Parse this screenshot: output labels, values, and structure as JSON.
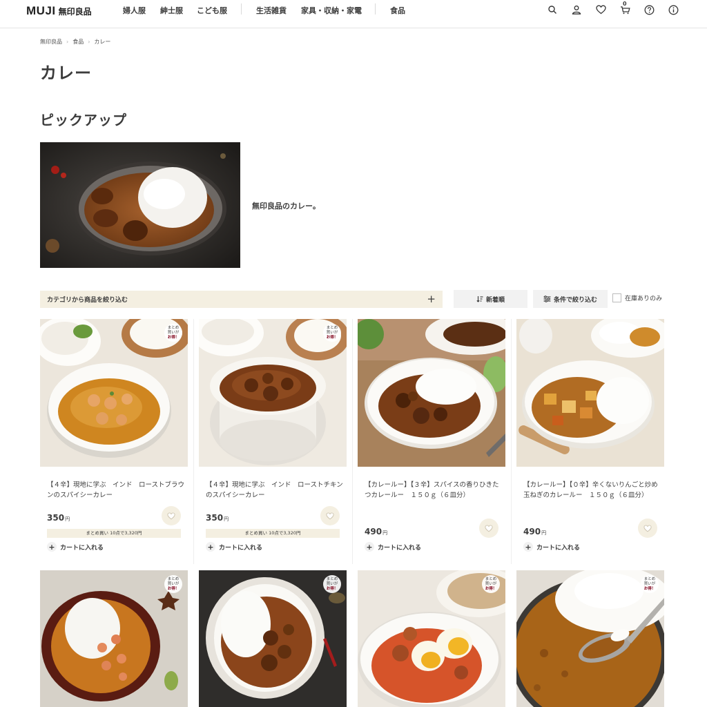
{
  "header": {
    "logo_en": "MUJI",
    "logo_jp": "無印良品",
    "nav": [
      "婦人服",
      "紳士服",
      "こども服",
      "生活雑貨",
      "家具・収納・家電",
      "食品"
    ],
    "cart_count": "0",
    "icons": [
      "search-icon",
      "user-icon",
      "heart-icon",
      "cart-icon",
      "help-icon",
      "info-icon"
    ]
  },
  "breadcrumb": [
    "無印良品",
    "食品",
    "カレー"
  ],
  "page_title": "カレー",
  "pickup": {
    "title": "ピックアップ",
    "text": "無印良品のカレー。"
  },
  "filters": {
    "category_label": "カテゴリから商品を絞り込む",
    "sort_label": "新着順",
    "filter_label": "条件で絞り込む",
    "stock_label": "在庫ありのみ"
  },
  "badge": {
    "line1": "まとめ",
    "line2": "買いが",
    "line3": "お得！"
  },
  "products": [
    {
      "name": "【４辛】現地に学ぶ　インド　ローストブラウンのスパイシーカレー",
      "price": "350",
      "yen": "円",
      "bulk": "まとめ買い 10点で3,320円",
      "cart_label": "カートに入れる",
      "badge": true
    },
    {
      "name": "【４辛】現地に学ぶ　インド　ローストチキンのスパイシーカレー",
      "price": "350",
      "yen": "円",
      "bulk": "まとめ買い 10点で3,320円",
      "cart_label": "カートに入れる",
      "badge": true
    },
    {
      "name": "【カレールー】【３辛】スパイスの香りひきたつカレールー　１５０ｇ（６皿分）",
      "price": "490",
      "yen": "円",
      "cart_label": "カートに入れる",
      "badge": false
    },
    {
      "name": "【カレールー】【０辛】辛くないりんごと炒め玉ねぎのカレールー　１５０ｇ（６皿分）",
      "price": "490",
      "yen": "円",
      "cart_label": "カートに入れる",
      "badge": false
    }
  ],
  "colors": {
    "accent_beige": "#f4efe1",
    "text": "#3c3c3c",
    "badge_red": "#7f0019"
  }
}
